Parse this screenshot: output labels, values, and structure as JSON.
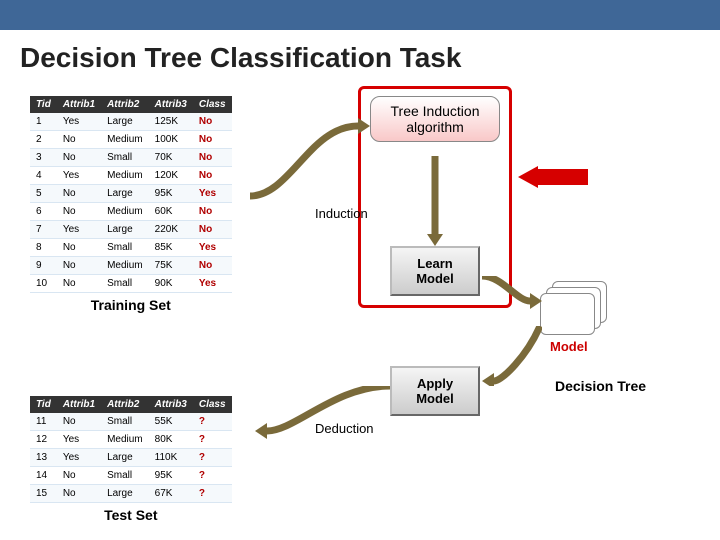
{
  "slide": {
    "title": "Decision Tree Classification Task"
  },
  "training": {
    "label": "Training Set",
    "headers": [
      "Tid",
      "Attrib1",
      "Attrib2",
      "Attrib3",
      "Class"
    ],
    "rows": [
      {
        "tid": "1",
        "a1": "Yes",
        "a2": "Large",
        "a3": "125K",
        "cls": "No"
      },
      {
        "tid": "2",
        "a1": "No",
        "a2": "Medium",
        "a3": "100K",
        "cls": "No"
      },
      {
        "tid": "3",
        "a1": "No",
        "a2": "Small",
        "a3": "70K",
        "cls": "No"
      },
      {
        "tid": "4",
        "a1": "Yes",
        "a2": "Medium",
        "a3": "120K",
        "cls": "No"
      },
      {
        "tid": "5",
        "a1": "No",
        "a2": "Large",
        "a3": "95K",
        "cls": "Yes"
      },
      {
        "tid": "6",
        "a1": "No",
        "a2": "Medium",
        "a3": "60K",
        "cls": "No"
      },
      {
        "tid": "7",
        "a1": "Yes",
        "a2": "Large",
        "a3": "220K",
        "cls": "No"
      },
      {
        "tid": "8",
        "a1": "No",
        "a2": "Small",
        "a3": "85K",
        "cls": "Yes"
      },
      {
        "tid": "9",
        "a1": "No",
        "a2": "Medium",
        "a3": "75K",
        "cls": "No"
      },
      {
        "tid": "10",
        "a1": "No",
        "a2": "Small",
        "a3": "90K",
        "cls": "Yes"
      }
    ]
  },
  "test": {
    "label": "Test Set",
    "headers": [
      "Tid",
      "Attrib1",
      "Attrib2",
      "Attrib3",
      "Class"
    ],
    "rows": [
      {
        "tid": "11",
        "a1": "No",
        "a2": "Small",
        "a3": "55K",
        "cls": "?"
      },
      {
        "tid": "12",
        "a1": "Yes",
        "a2": "Medium",
        "a3": "80K",
        "cls": "?"
      },
      {
        "tid": "13",
        "a1": "Yes",
        "a2": "Large",
        "a3": "110K",
        "cls": "?"
      },
      {
        "tid": "14",
        "a1": "No",
        "a2": "Small",
        "a3": "95K",
        "cls": "?"
      },
      {
        "tid": "15",
        "a1": "No",
        "a2": "Large",
        "a3": "67K",
        "cls": "?"
      }
    ]
  },
  "boxes": {
    "algorithm": "Tree Induction algorithm",
    "learn": "Learn Model",
    "apply": "Apply Model",
    "model": "Model",
    "decision_tree": "Decision Tree",
    "induction": "Induction",
    "deduction": "Deduction"
  }
}
